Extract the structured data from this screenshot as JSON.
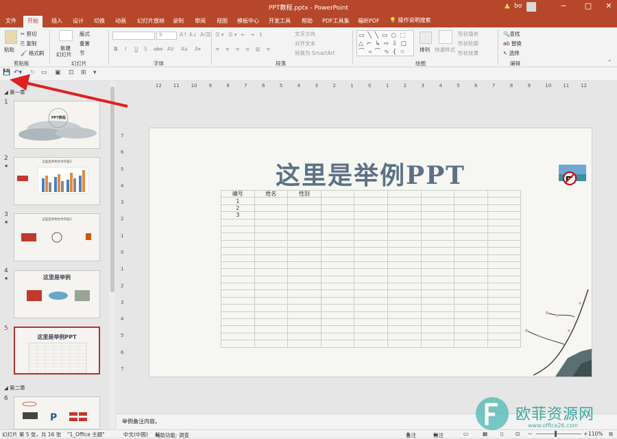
{
  "window": {
    "title": "PPT教程.pptx  -  PowerPoint",
    "user": "bo",
    "warning_icon": "warning-icon",
    "controls": [
      "−",
      "□",
      "✕"
    ]
  },
  "tabs": [
    "文件",
    "开始",
    "插入",
    "设计",
    "切换",
    "动画",
    "幻灯片放映",
    "录制",
    "审阅",
    "视图",
    "模板中心",
    "开发工具",
    "帮助",
    "PDF工具集",
    "福昕PDF"
  ],
  "active_tab": "开始",
  "tell_me": "操作说明搜索",
  "ribbon": {
    "clipboard": {
      "paste": "粘贴",
      "cut": "剪切",
      "copy": "复制",
      "format_painter": "格式刷",
      "group": "剪贴板"
    },
    "slides": {
      "new_slide": "新建",
      "new_slide2": "幻灯片",
      "layout": "版式",
      "reset": "重置",
      "section": "节",
      "group": "幻灯片"
    },
    "font": {
      "size": "9",
      "bold": "B",
      "italic": "I",
      "underline": "U",
      "shadow": "S",
      "strike": "abc",
      "spacing": "AV",
      "case": "Aa",
      "group": "字体"
    },
    "paragraph": {
      "text_direction": "文字方向",
      "align_text": "对齐文本",
      "smartart": "转换为 SmartArt",
      "group": "段落"
    },
    "drawing": {
      "arrange": "排列",
      "quick_styles": "快速样式",
      "fill": "形状填充",
      "outline": "形状轮廓",
      "effects": "形状效果",
      "group": "绘图"
    },
    "editing": {
      "find": "查找",
      "replace": "替换",
      "select": "选择",
      "group": "编辑"
    }
  },
  "thumbnails": {
    "sections": [
      "第一章",
      "第二章"
    ],
    "slides": [
      {
        "num": "1",
        "text": "PPT教程"
      },
      {
        "num": "2",
        "text": "这里是举例文件内容2"
      },
      {
        "num": "3",
        "text": "这里是举例文件内容3"
      },
      {
        "num": "4",
        "text": "这里是举例"
      },
      {
        "num": "5",
        "text": "这里是举例PPT"
      },
      {
        "num": "6",
        "text": ""
      }
    ]
  },
  "ruler": {
    "h": [
      "12",
      "11",
      "10",
      "9",
      "8",
      "7",
      "6",
      "5",
      "4",
      "3",
      "2",
      "1",
      "0",
      "1",
      "2",
      "3",
      "4",
      "5",
      "6",
      "7",
      "8",
      "9",
      "10",
      "11",
      "12"
    ],
    "v": [
      "7",
      "6",
      "5",
      "4",
      "3",
      "2",
      "1",
      "0",
      "1",
      "2",
      "3",
      "4",
      "5",
      "6",
      "7"
    ]
  },
  "slide": {
    "title": "这里是举例PPT",
    "table_headers": [
      "编号",
      "姓名",
      "性别"
    ],
    "table_rows": [
      "1",
      "2",
      "3"
    ]
  },
  "notes": "举例备注内容。",
  "status": {
    "slide_info": "幻灯片 第 5 张，共 16 张",
    "theme": "\"1_Office 主题\"",
    "language": "中文(中国)",
    "accessibility": "辅助功能: 调查",
    "notes_btn": "备注",
    "comments_btn": "批注",
    "zoom": "110%"
  },
  "watermark": {
    "text": "欧菲资源网",
    "url": "www.office26.com"
  },
  "colors": {
    "accent": "#b7472a",
    "slide_title": "#5c7184",
    "arrow": "#e02020"
  }
}
